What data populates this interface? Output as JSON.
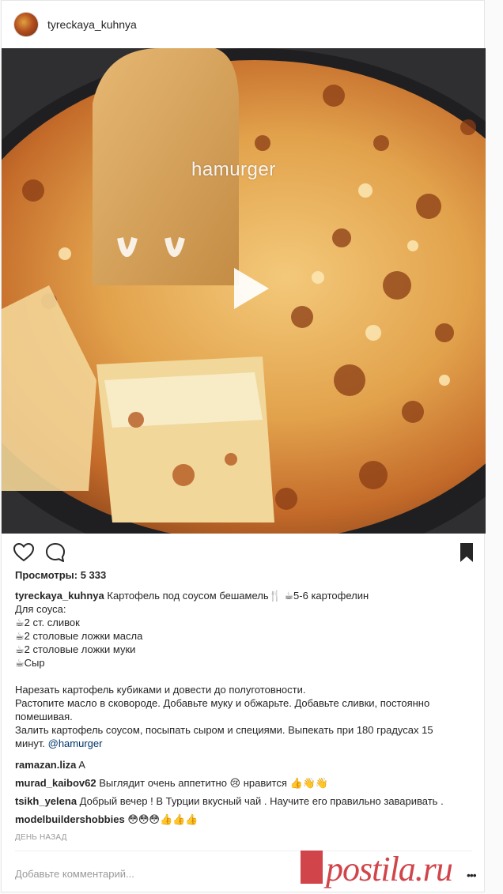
{
  "post": {
    "username": "tyreckaya_kuhnya",
    "media": {
      "watermark": "hamurger"
    },
    "views_label": "Просмотры: 5 333",
    "caption": {
      "user": "tyreckaya_kuhnya",
      "lines": [
        "Картофель под соусом бешамель🍴 ☕5-6 картофелин",
        "Для соуса:",
        "☕2 ст. сливок",
        "☕2 столовые ложки масла",
        "☕2 столовые ложки муки",
        "☕Сыр"
      ],
      "paragraph_lines": [
        "Нарезать картофель кубиками и довести до полуготовности.",
        "Растопите масло в сковороде. Добавьте муку и обжарьте. Добавьте сливки, постоянно",
        "помешивая.",
        "Залить картофель соусом, посыпать сыром и специями. Выпекать при 180 градусах 15"
      ],
      "last_line_text": "минут. ",
      "mention": "@hamurger"
    },
    "comments": [
      {
        "user": "ramazan.liza",
        "text": "A"
      },
      {
        "user": "murad_kaibov62",
        "text": "Выглядит очень аппетитно 😢 нравится 👍👋👋"
      },
      {
        "user": "tsikh_yelena",
        "text": "Добрый вечер ! В Турции вкусный чай . Научите его правильно заваривать ."
      },
      {
        "user": "modelbuildershobbies",
        "text": "😳😳😳👍👍👍"
      }
    ],
    "timestamp": "день назад",
    "add_comment_placeholder": "Добавьте комментарий...",
    "more_label": "•••",
    "icons": {
      "like": "heart-icon",
      "comment": "comment-bubble-icon",
      "save": "bookmark-icon",
      "play": "play-icon"
    }
  },
  "overlay": {
    "brand": "postila.ru",
    "brand_color": "#c9232a"
  }
}
